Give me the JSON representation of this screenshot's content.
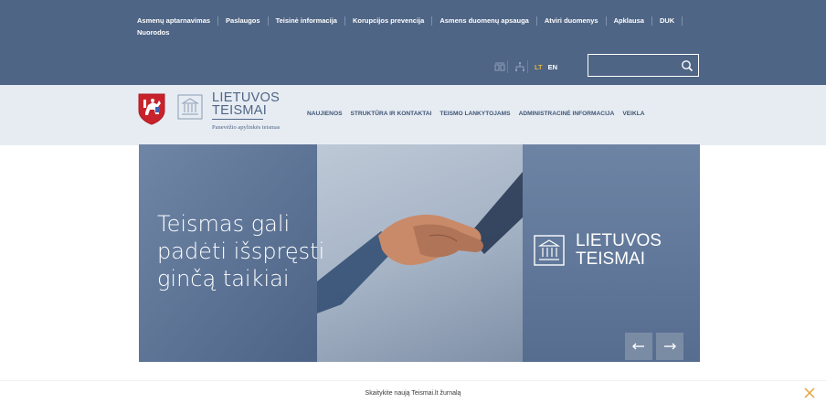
{
  "top_nav": {
    "items": [
      "Asmenų aptarnavimas",
      "Paslaugos",
      "Teisinė informacija",
      "Korupcijos prevencija",
      "Asmens duomenų apsauga",
      "Atviri duomenys",
      "Apklausa",
      "DUK",
      "Nuorodos"
    ]
  },
  "tools": {
    "icons": [
      "sign-language-icon",
      "sitemap-icon"
    ],
    "lang_lt": "LT",
    "lang_en": "EN",
    "search_placeholder": ""
  },
  "logo": {
    "title_line1": "LIETUVOS",
    "title_line2": "TEISMAI",
    "subtitle": "Panevėžio apylinkės teismas"
  },
  "main_nav": {
    "items": [
      "NAUJIENOS",
      "STRUKTŪRA IR KONTAKTAI",
      "TEISMO LANKYTOJAMS",
      "ADMINISTRACINĖ INFORMACIJA",
      "VEIKLA"
    ]
  },
  "hero": {
    "line1": "Teismas gali",
    "line2": "padėti išspręsti",
    "line3": "ginčą taikiai",
    "brand_line1": "LIETUVOS",
    "brand_line2": "TEISMAI",
    "prev_label": "←",
    "next_label": "→"
  },
  "notice": {
    "text": "Skaitykite naują Teismai.lt žurnalą",
    "close_label": "✕"
  },
  "colors": {
    "topbar": "#4f6585",
    "header": "#e7ecf3",
    "accent_lang": "#e6b23c",
    "close": "#e6a23c"
  }
}
